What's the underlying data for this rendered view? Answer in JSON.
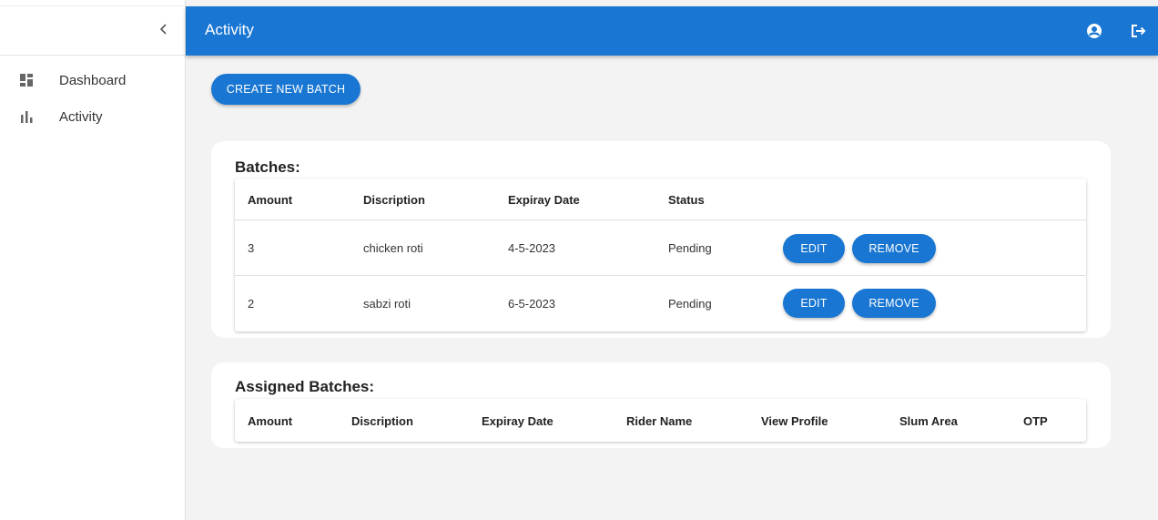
{
  "app": {
    "page_title": "Activity"
  },
  "sidebar": {
    "items": [
      {
        "label": "Dashboard",
        "icon": "dashboard-icon"
      },
      {
        "label": "Activity",
        "icon": "bar-chart-icon"
      }
    ]
  },
  "header": {
    "title": "Activity",
    "icons": [
      "account-circle-icon",
      "logout-icon"
    ]
  },
  "colors": {
    "primary": "#1976d2",
    "background": "#f3f3f3"
  },
  "actions": {
    "create_batch_label": "CREATE NEW BATCH"
  },
  "batches": {
    "title": "Batches:",
    "columns": [
      "Amount",
      "Discription",
      "Expiray Date",
      "Status"
    ],
    "rows": [
      {
        "amount": "3",
        "description": "chicken roti",
        "expiry": "4-5-2023",
        "status": "Pending",
        "edit_label": "EDIT",
        "remove_label": "REMOVE"
      },
      {
        "amount": "2",
        "description": "sabzi roti",
        "expiry": "6-5-2023",
        "status": "Pending",
        "edit_label": "EDIT",
        "remove_label": "REMOVE"
      }
    ]
  },
  "assigned_batches": {
    "title": "Assigned Batches:",
    "columns": [
      "Amount",
      "Discription",
      "Expiray Date",
      "Rider Name",
      "View Profile",
      "Slum Area",
      "OTP"
    ]
  }
}
